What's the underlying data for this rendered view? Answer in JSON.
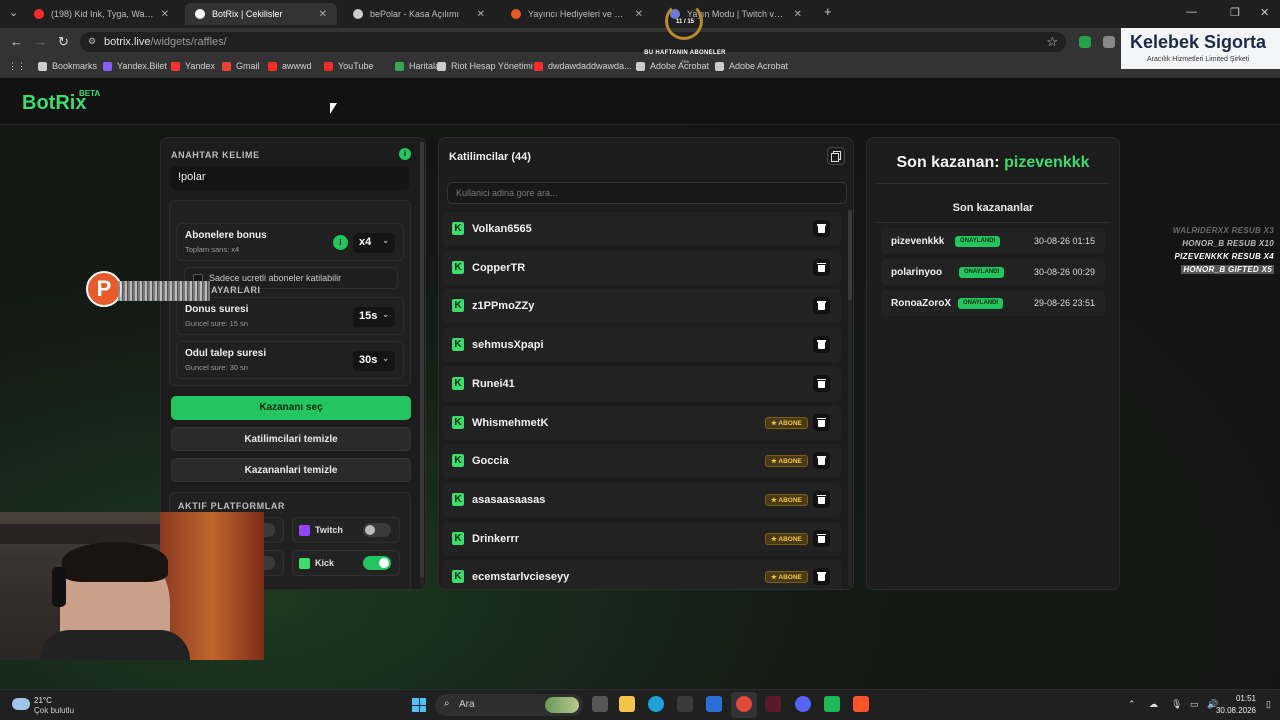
{
  "browser": {
    "tabs": [
      {
        "title": "(198) Kid Ink, Tyga, Wale, Y...",
        "color": "#ff2a2a",
        "active": false
      },
      {
        "title": "BotRix | Cekilisler",
        "color": "#ffffff",
        "active": true
      },
      {
        "title": "bePolar - Kasa Açılımı",
        "color": "#cccccc",
        "active": false
      },
      {
        "title": "Yayıncı Hediyeleri ve Kazananlar",
        "color": "#e85a2a",
        "active": false
      },
      {
        "title": "Yayın Modu | Twitch ve Kick ile",
        "color": "#6a7bd8",
        "active": false
      }
    ],
    "url_host": "botrix.live",
    "url_path": "/widgets/raffles/",
    "bookmarks": [
      {
        "label": "Bookmarks",
        "color": "#cccccc"
      },
      {
        "label": "Yandex.Bilet",
        "color": "#8a5cf6"
      },
      {
        "label": "Yandex",
        "color": "#ff3333"
      },
      {
        "label": "Gmail",
        "color": "#ea4335"
      },
      {
        "label": "awwwd",
        "color": "#ff2a2a"
      },
      {
        "label": "YouTube",
        "color": "#ff2a2a"
      },
      {
        "label": "Haritalar",
        "color": "#34a853"
      },
      {
        "label": "Riot Hesap Yönetimi",
        "color": "#cccccc"
      },
      {
        "label": "dwdawdaddwawda...",
        "color": "#ff2a2a"
      },
      {
        "label": "Adobe Acrobat",
        "color": "#cccccc"
      },
      {
        "label": "Adobe Acrobat",
        "color": "#cccccc"
      }
    ]
  },
  "overlay": {
    "sub_count": "11 / 15",
    "sub_label": "BU HAFTANIN ABONELER",
    "sub_pct": "73%",
    "sponsor_name": "Kelebek Sigorta",
    "sponsor_sub": "Aracılık Hizmetleri Limited Şirketi",
    "avatar_letter": "P",
    "feed": [
      {
        "text": "WALRIDERXX RESUB X3",
        "color": "#6a6a6a"
      },
      {
        "text": "HONOR_B RESUB X10",
        "color": "#bdbdbd"
      },
      {
        "text": "PIZEVENKKK RESUB X4",
        "color": "#ffffff"
      },
      {
        "text": "HONOR_B GIFTED X5",
        "color": "#ffffff"
      }
    ]
  },
  "app": {
    "logo": "BotRix",
    "logo_badge": "BETA"
  },
  "settings": {
    "keyword_title": "ANAHTAR KELIME",
    "keyword_value": "!polar",
    "section_title": "AYARLARI",
    "bonus_title": "Abonelere bonus",
    "bonus_sub": "Toplam sans: x4",
    "bonus_value": "x4",
    "only_subs_label": "Sadece ucretli aboneler katilabilir",
    "duration_title": "Donus suresi",
    "duration_sub": "Guncel sure: 15 sn",
    "duration_value": "15s",
    "claim_title": "Odul talep suresi",
    "claim_sub": "Guncel sure: 30 sn",
    "claim_value": "30s",
    "btn_pick": "Kazananı seç",
    "btn_clear_participants": "Katilimcilari temizle",
    "btn_clear_winners": "Kazananlari temizle",
    "platforms_title": "AKTIF PLATFORMLAR",
    "platforms": [
      {
        "name": "Twitch",
        "on": false,
        "color": "#9146ff"
      },
      {
        "name": "Kick",
        "on": true,
        "color": "#3ddc6c"
      }
    ]
  },
  "participants": {
    "title": "Katilimcilar (44)",
    "search_placeholder": "Kullanici adina gore ara...",
    "sub_badge": "★ ABONE",
    "list": [
      {
        "name": "Volkan6565",
        "sub": false
      },
      {
        "name": "CopperTR",
        "sub": false
      },
      {
        "name": "z1PPmoZZy",
        "sub": false
      },
      {
        "name": "sehmusXpapi",
        "sub": false
      },
      {
        "name": "Runei41",
        "sub": false
      },
      {
        "name": "WhismehmetK",
        "sub": true
      },
      {
        "name": "Goccia",
        "sub": true
      },
      {
        "name": "asasaasaasas",
        "sub": true
      },
      {
        "name": "Drinkerrr",
        "sub": true
      },
      {
        "name": "ecemstarlvcieseyy",
        "sub": true
      }
    ]
  },
  "winners": {
    "latest_prefix": "Son kazanan:",
    "latest_name": "pizevenkkk",
    "subtitle": "Son kazananlar",
    "status": "ONAYLANDI",
    "list": [
      {
        "name": "pizevenkkk",
        "date": "30-08-26 01:15"
      },
      {
        "name": "polarinyoo",
        "date": "30-08-26 00:29"
      },
      {
        "name": "RonoaZoroX",
        "date": "29-08-26 23:51"
      }
    ]
  },
  "taskbar": {
    "temp": "21°C",
    "weather": "Çok bulutlu",
    "search": "Ara",
    "time": "01:51",
    "date": "30.08.2026"
  }
}
